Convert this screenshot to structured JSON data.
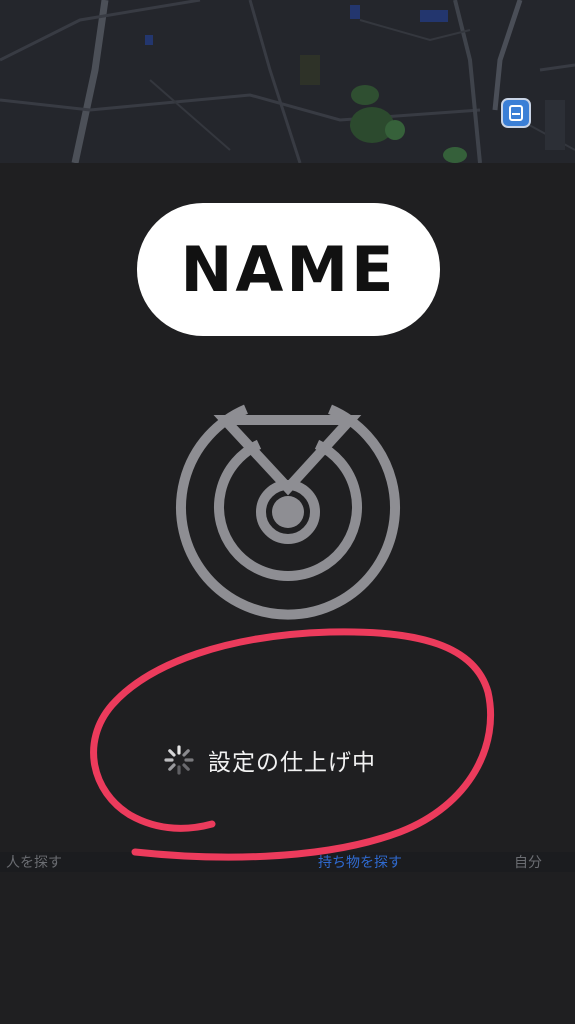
{
  "badge": {
    "label": "NAME"
  },
  "status": {
    "text": "設定の仕上げ中"
  },
  "bottom_tabs": [
    {
      "label": "人を探す"
    },
    {
      "label": "持ち物を探す"
    },
    {
      "label": "自分"
    }
  ],
  "icons": {
    "map_station": "train-station-icon",
    "radar": "radar-icon",
    "spinner": "loading-spinner-icon"
  },
  "colors": {
    "panel_background": "#1f1f21",
    "radar_gray": "#8e8e93",
    "annotation_red": "#ec3b5c",
    "tab_active": "#2f6ad0"
  }
}
